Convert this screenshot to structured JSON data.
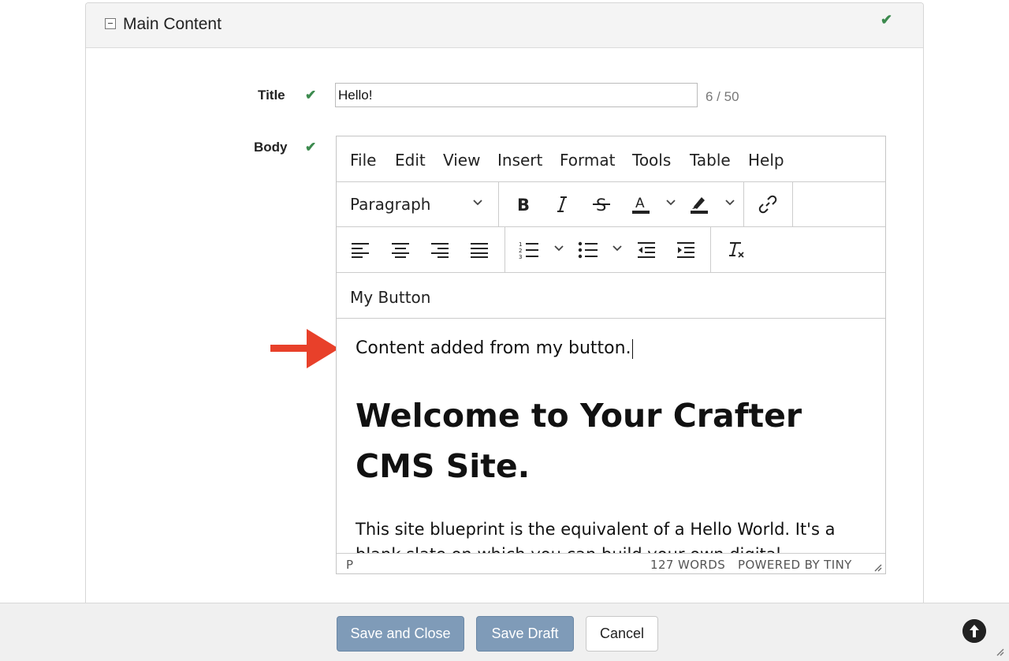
{
  "panel": {
    "title": "Main Content"
  },
  "fields": {
    "title": {
      "label": "Title",
      "value": "Hello!",
      "counter": "6 / 50"
    },
    "body": {
      "label": "Body"
    }
  },
  "editor": {
    "menu": [
      "File",
      "Edit",
      "View",
      "Insert",
      "Format",
      "Tools",
      "Table",
      "Help"
    ],
    "block_format": "Paragraph",
    "custom_button": "My Button",
    "content": {
      "line1": "Content added from my button.",
      "heading": "Welcome to Your Crafter CMS Site.",
      "paragraph": "This site blueprint is the equivalent of a Hello World. It's a blank slate on which you can build your own digital"
    },
    "status": {
      "path": "P",
      "words": "127 WORDS",
      "powered": "POWERED BY TINY"
    }
  },
  "footer": {
    "save_close": "Save and Close",
    "save_draft": "Save Draft",
    "cancel": "Cancel"
  },
  "colors": {
    "check": "#3c8a4e",
    "arrow": "#e8402a",
    "primary_button": "#7f9bb8"
  },
  "icons": [
    "collapse-icon",
    "check-icon",
    "bold-icon",
    "italic-icon",
    "strikethrough-icon",
    "text-color-icon",
    "highlight-icon",
    "link-icon",
    "align-left-icon",
    "align-center-icon",
    "align-right-icon",
    "justify-icon",
    "numbered-list-icon",
    "bullet-list-icon",
    "outdent-icon",
    "indent-icon",
    "clear-formatting-icon",
    "resize-icon",
    "arrow-up-icon"
  ]
}
